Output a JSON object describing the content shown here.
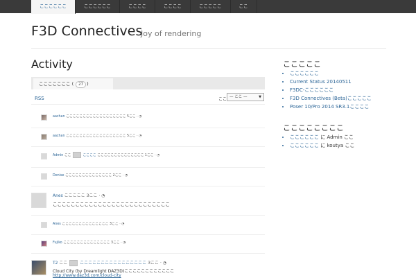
{
  "nav": {
    "items": [
      "ここここここ",
      "ここここここ",
      "ここここ",
      "ここここ",
      "こここここ",
      "ここ"
    ]
  },
  "site": {
    "title": "F3D Connectives",
    "tagline": "Joy of rendering"
  },
  "main": {
    "title": "Activity",
    "tab_label": "こここここここ",
    "tab_count": "27",
    "rss": "RSS",
    "filter_label": "ここ:",
    "filter_value": "— ここ —"
  },
  "activity": [
    {
      "user": "aachan",
      "text": "ここここここここここここここここここ 5ここ",
      "sep": "·"
    },
    {
      "user": "aachan",
      "text": "ここここここここここここここここここ 5ここ",
      "sep": "·"
    },
    {
      "user": "Admin",
      "mid": "ここ",
      "link": "ここここ",
      "text": "ここここここここここここここ 1ここ",
      "sep": "·"
    },
    {
      "user": "Denise",
      "text": "ここここここここここここここ 2ここ",
      "sep": "·"
    },
    {
      "user": "Anes",
      "text": "こここここ 3ここ",
      "sep": "·",
      "content": "ここここここここここここここここここここここここここ"
    },
    {
      "user": "Anes",
      "text": "ここここここここここここここ 3ここ",
      "sep": "·"
    },
    {
      "user": "Fujiko",
      "text": "ここここここここここここここ 3ここ",
      "sep": "·"
    },
    {
      "user": "T2",
      "mid": "ここ",
      "link": "ここここここここここここここここ",
      "text": "3ここ",
      "sep": "·",
      "content": "Cloud City (by Dreamlight DAZ3D)ここここここここここここ",
      "url": "http://www.daz3d.com/cloud-city"
    }
  ],
  "sidebar": {
    "recent_title": "こここここ",
    "recent": [
      "ここここここ",
      "Current Status 20140511",
      "F3DC-ここここここ",
      "F3D Connectives (Beta)こここここ",
      "Poser 10/Pro 2014 SR3.1ここここ"
    ],
    "comments_title": "ここここここここ",
    "comments": [
      {
        "post": "ここここここ",
        "mid": " に Admin ここ"
      },
      {
        "post": "ここここここ",
        "mid": " に koutya ここ"
      }
    ]
  }
}
